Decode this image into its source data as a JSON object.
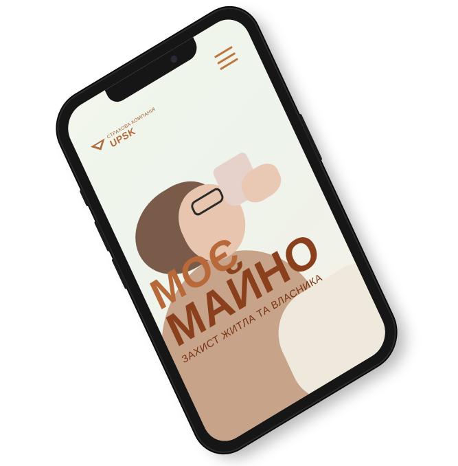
{
  "brand": {
    "subtitle": "СТРАХОВА КОМПАНІЯ",
    "name": "UPSK"
  },
  "hero": {
    "line1": "МОЄ",
    "line2": "МАЙНО",
    "subtitle": "ЗАХИСТ ЖИТЛА ТА ВЛАСНИКА"
  },
  "icons": {
    "menu": "hamburger-menu-icon",
    "logo": "upsk-logo-icon"
  },
  "colors": {
    "accent": "#c0753f",
    "headline_light": "#b8693a",
    "headline_dark": "#8a3f1d",
    "phone_frame": "#161616"
  }
}
